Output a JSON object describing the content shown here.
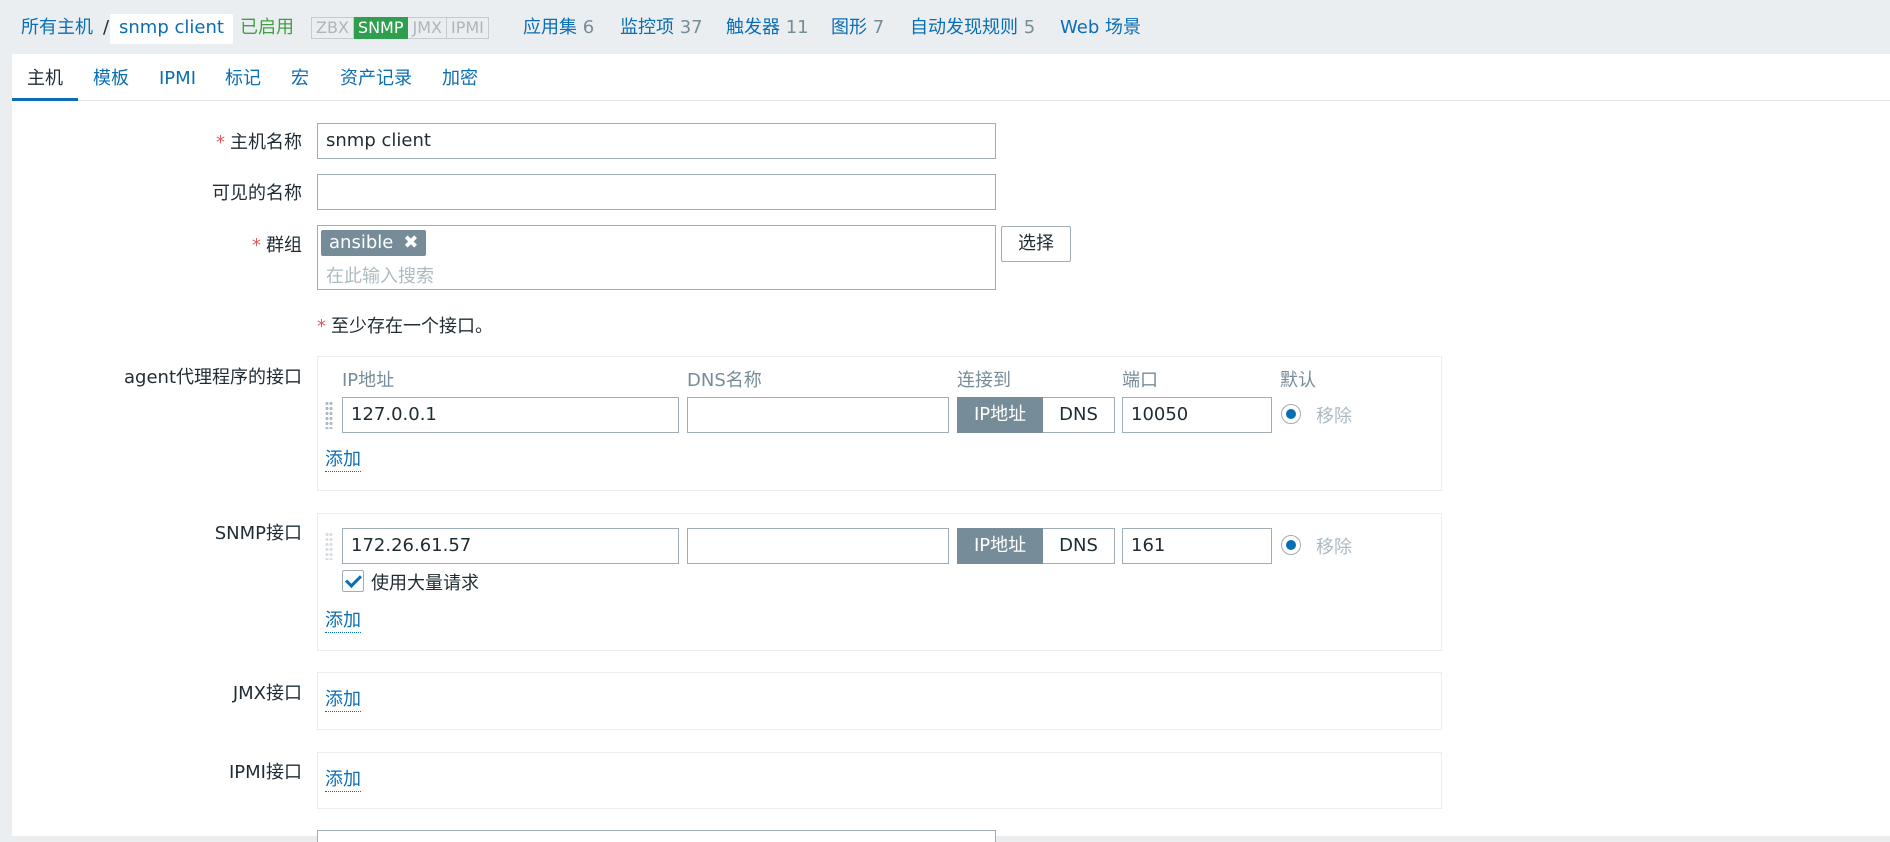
{
  "breadcrumb": {
    "all_hosts": "所有主机",
    "separator": "/",
    "current_host": "snmp client",
    "status": "已启用"
  },
  "availability": {
    "zbx": "ZBX",
    "snmp": "SNMP",
    "jmx": "JMX",
    "ipmi": "IPMI",
    "active": "SNMP"
  },
  "host_links": [
    {
      "label": "应用集",
      "count": "6"
    },
    {
      "label": "监控项",
      "count": "37"
    },
    {
      "label": "触发器",
      "count": "11"
    },
    {
      "label": "图形",
      "count": "7"
    },
    {
      "label": "自动发现规则",
      "count": "5"
    },
    {
      "label": "Web 场景",
      "count": ""
    }
  ],
  "tabs": [
    "主机",
    "模板",
    "IPMI",
    "标记",
    "宏",
    "资产记录",
    "加密"
  ],
  "active_tab": "主机",
  "form": {
    "required_mark": "*",
    "host_name_label": "主机名称",
    "host_name_value": "snmp client",
    "visible_name_label": "可见的名称",
    "visible_name_value": "",
    "groups_label": "群组",
    "group_chip": "ansible",
    "group_chip_remove": "✖",
    "groups_placeholder": "在此输入搜索",
    "select_button": "选择",
    "interface_notice": "至少存在一个接口。"
  },
  "interfaces": {
    "columns": {
      "ip": "IP地址",
      "dns": "DNS名称",
      "connect_to": "连接到",
      "port": "端口",
      "default": "默认"
    },
    "agent": {
      "label": "agent代理程序的接口",
      "ip": "127.0.0.1",
      "dns": "",
      "connect_ip": "IP地址",
      "connect_dns": "DNS",
      "port": "10050",
      "remove": "移除",
      "add": "添加"
    },
    "snmp": {
      "label": "SNMP接口",
      "ip": "172.26.61.57",
      "dns": "",
      "connect_ip": "IP地址",
      "connect_dns": "DNS",
      "port": "161",
      "remove": "移除",
      "bulk_label": "使用大量请求",
      "bulk_checked": true,
      "add": "添加"
    },
    "jmx": {
      "label": "JMX接口",
      "add": "添加"
    },
    "ipmi": {
      "label": "IPMI接口",
      "add": "添加"
    }
  },
  "colors": {
    "link": "#0a6eb4",
    "enabled": "#429e47",
    "snmp_badge": "#2f9f4f",
    "required": "#e45959",
    "chip": "#768d99"
  }
}
